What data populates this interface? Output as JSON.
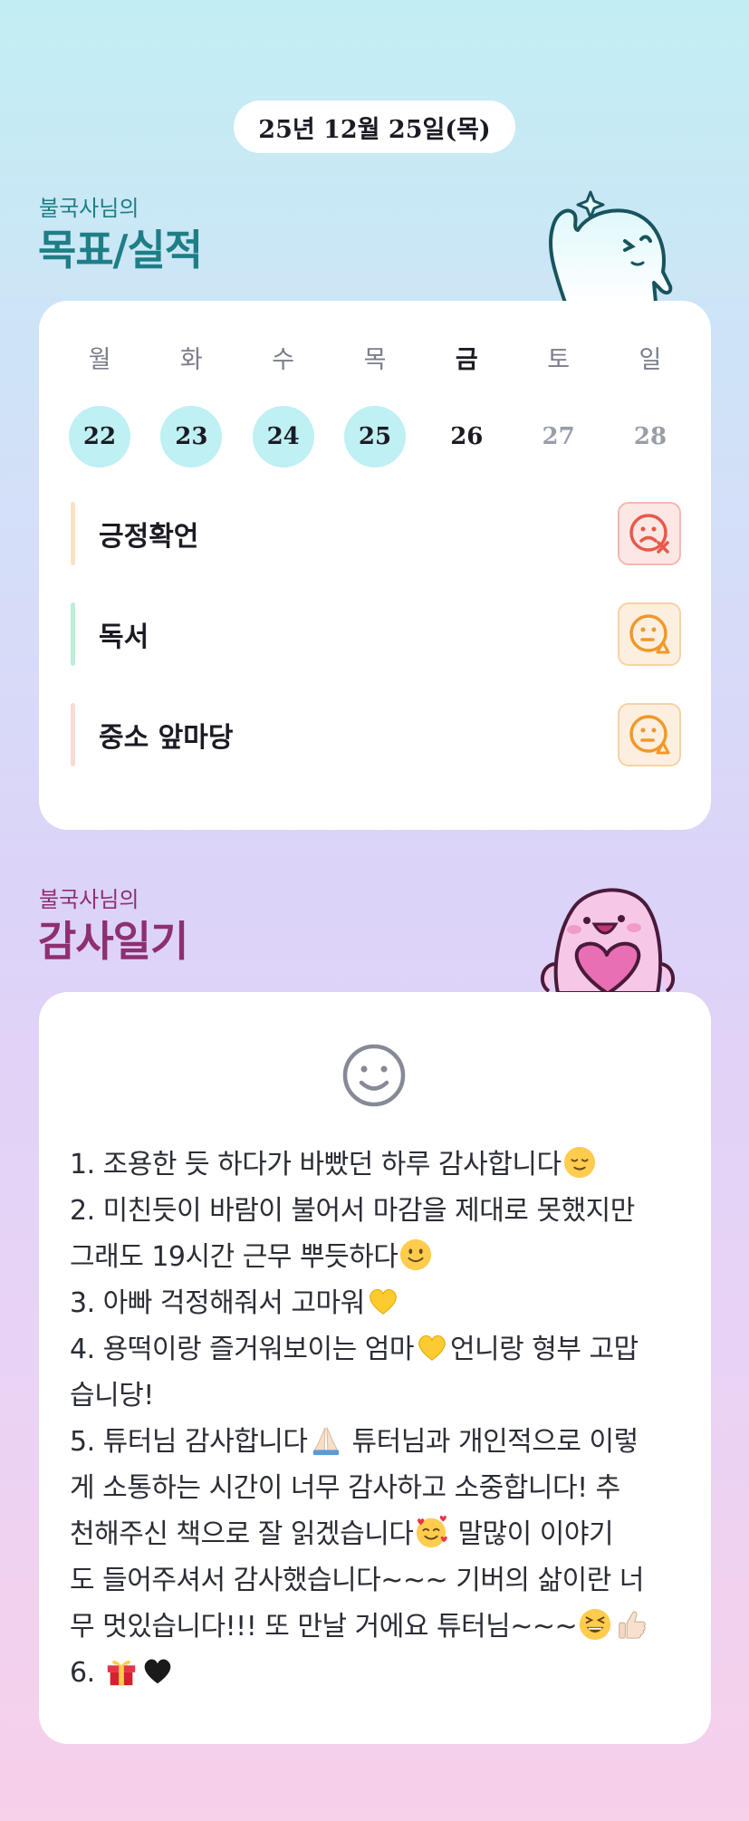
{
  "header": {
    "date": "25년 12월 25일(목)"
  },
  "goals_section": {
    "subtitle": "불국사님의",
    "title": "목표/실적"
  },
  "week": [
    {
      "name": "월",
      "date": "22",
      "state": "done"
    },
    {
      "name": "화",
      "date": "23",
      "state": "done"
    },
    {
      "name": "수",
      "date": "24",
      "state": "done"
    },
    {
      "name": "목",
      "date": "25",
      "state": "done"
    },
    {
      "name": "금",
      "date": "26",
      "state": "today"
    },
    {
      "name": "토",
      "date": "27",
      "state": "future"
    },
    {
      "name": "일",
      "date": "28",
      "state": "future"
    }
  ],
  "goals": [
    {
      "label": "긍정확언",
      "bar_color": "#fde0c2",
      "status_icon": "sad-face-x-icon",
      "status_color": "#e8594a"
    },
    {
      "label": "독서",
      "bar_color": "#bdeed8",
      "status_icon": "neutral-face-triangle-icon",
      "status_color": "#f0982a"
    },
    {
      "label": "중소 앞마당",
      "bar_color": "#fcd9d4",
      "status_icon": "neutral-face-triangle-icon",
      "status_color": "#f0982a"
    }
  ],
  "diary_section": {
    "subtitle": "불국사님의",
    "title": "감사일기"
  },
  "diary": {
    "mood_icon": "smile-icon",
    "lines": {
      "l1": "1. 조용한 듯 하다가 바빴던 하루 감사합니다",
      "l2a": "2. 미친듯이 바람이 불어서 마감을 제대로 못했지만",
      "l2b": "그래도 19시간 근무 뿌듯하다",
      "l3": "3. 아빠 걱정해줘서 고마워",
      "l4a": "4. 용떡이랑 즐거워보이는 엄마",
      "l4b": "언니랑 형부 고맙",
      "l4c": "습니당!",
      "l5a": "5. 튜터님 감사합니다",
      "l5b": " 튜터님과 개인적으로 이렇",
      "l5c": "게 소통하는 시간이 너무 감사하고 소중합니다! 추",
      "l5d": "천해주신 책으로 잘 읽겠습니다",
      "l5e": " 말많이 이야기",
      "l5f": "도 들어주셔서 감사했습니다~~~ 기버의 삶이란 너",
      "l5g": "무 멋있습니다!!! 또 만날 거에요 튜터님~~~",
      "l6": "6. "
    }
  },
  "colors": {
    "teal": "#1e7e86",
    "purple": "#8e2f72",
    "done_day": "#bff0f3"
  }
}
